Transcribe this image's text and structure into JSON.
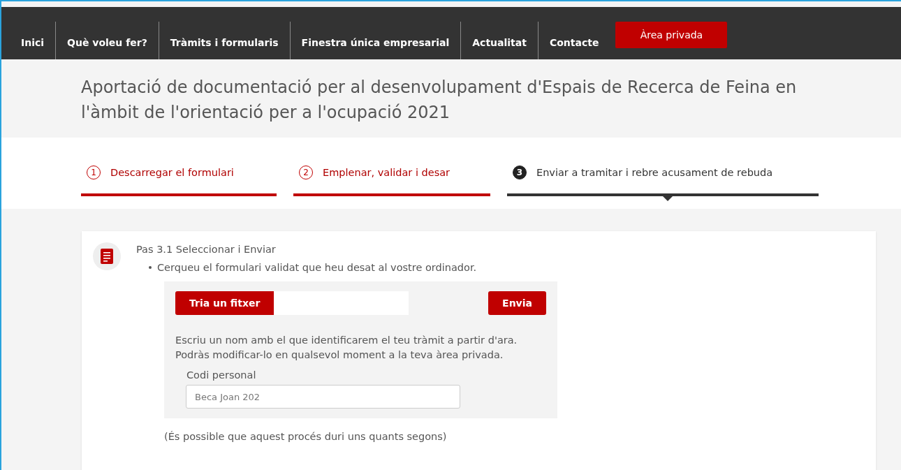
{
  "nav": {
    "items": [
      {
        "label": "Inici"
      },
      {
        "label": "Què voleu fer?"
      },
      {
        "label": "Tràmits i formularis"
      },
      {
        "label": "Finestra única empresarial"
      },
      {
        "label": "Actualitat"
      },
      {
        "label": "Contacte"
      }
    ],
    "private_button": "Àrea privada"
  },
  "page_title": "Aportació de documentació per al desenvolupament d'Espais de Recerca de Feina en l'àmbit de l'orientació per a l'ocupació 2021",
  "steps": [
    {
      "number": "1",
      "label": "Descarregar el formulari",
      "selected": false
    },
    {
      "number": "2",
      "label": "Emplenar, validar i desar",
      "selected": false
    },
    {
      "number": "3",
      "label": "Enviar a tramitar i rebre acusament de rebuda",
      "selected": true
    }
  ],
  "card": {
    "heading": "Pas 3.1 Seleccionar i Enviar",
    "bullet": "Cerqueu el formulari validat que heu desat al vostre ordinador.",
    "choose_button": "Tria un fitxer",
    "send_button": "Envia",
    "hint": "Escriu un nom amb el que identificarem el teu tràmit a partir d'ara. Podràs modificar-lo en qualsevol moment a la teva àrea privada.",
    "field_label": "Codi personal",
    "field_value": "Beca Joan 202",
    "note": "(És possible que aquest procés duri uns quants segons)"
  }
}
